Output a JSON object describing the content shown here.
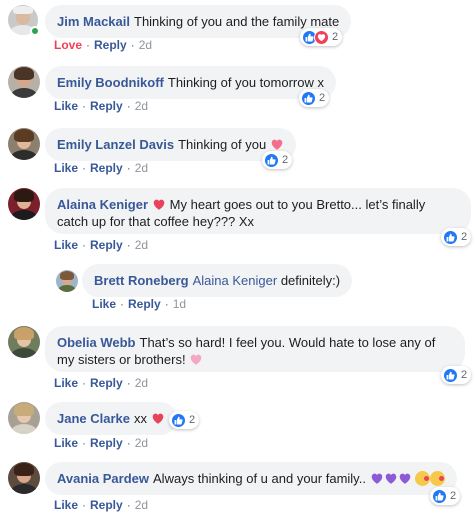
{
  "colors": {
    "link": "#385898",
    "love": "#f33e58",
    "like": "#2078f4",
    "bubble": "#f2f3f5"
  },
  "icons": {
    "like": "thumbs-up-icon",
    "love": "heart-icon",
    "purple_heart": "purple-heart-icon",
    "kiss": "kissing-face-icon"
  },
  "comments": [
    {
      "name": "Jim Mackail",
      "text": "Thinking of you and the family mate",
      "action1": "Love",
      "action2": "Reply",
      "time": "2d",
      "reactions": "2"
    },
    {
      "name": "Emily Boodnikoff",
      "text": "Thinking of you tomorrow x",
      "action1": "Like",
      "action2": "Reply",
      "time": "2d",
      "reactions": "2"
    },
    {
      "name": "Emily Lanzel Davis",
      "text": "Thinking of you",
      "action1": "Like",
      "action2": "Reply",
      "time": "2d",
      "reactions": "2"
    },
    {
      "name": "Alaina Keniger",
      "text": "My heart goes out to you Bretto... let’s finally catch up for that coffee hey??? Xx",
      "action1": "Like",
      "action2": "Reply",
      "time": "2d",
      "reactions": "2"
    },
    {
      "name": "Brett Roneberg",
      "mention": "Alaina Keniger",
      "text": "definitely:)",
      "action1": "Like",
      "action2": "Reply",
      "time": "1d"
    },
    {
      "name": "Obelia Webb",
      "text": "That’s so hard! I feel you. Would hate to lose any of my sisters or brothers!",
      "action1": "Like",
      "action2": "Reply",
      "time": "2d",
      "reactions": "2"
    },
    {
      "name": "Jane Clarke",
      "text": "xx",
      "action1": "Like",
      "action2": "Reply",
      "time": "2d",
      "reactions": "2"
    },
    {
      "name": "Avania Pardew",
      "text": "Always thinking of u and your family..",
      "action1": "Like",
      "action2": "Reply",
      "time": "2d",
      "reactions": "2"
    }
  ]
}
